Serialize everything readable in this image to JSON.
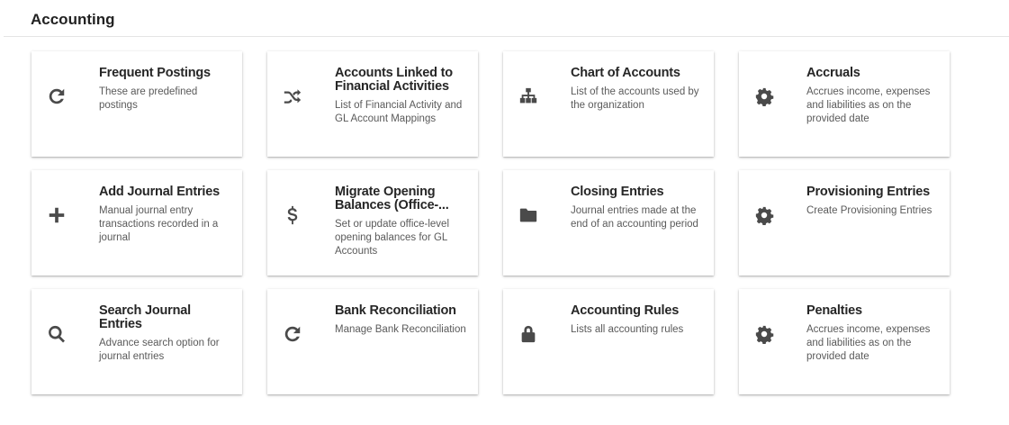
{
  "page": {
    "title": "Accounting"
  },
  "cards": [
    {
      "name": "frequent-postings",
      "icon": "refresh-icon",
      "title": "Frequent Postings",
      "desc": "These are predefined postings"
    },
    {
      "name": "accounts-linked",
      "icon": "shuffle-icon",
      "title": "Accounts Linked to Financial Activities",
      "desc": "List of Financial Activity and GL Account Mappings"
    },
    {
      "name": "chart-of-accounts",
      "icon": "sitemap-icon",
      "title": "Chart of Accounts",
      "desc": "List of the accounts used by the organization"
    },
    {
      "name": "accruals",
      "icon": "gear-icon",
      "title": "Accruals",
      "desc": "Accrues income, expenses and liabilities as on the provided date"
    },
    {
      "name": "add-journal-entries",
      "icon": "plus-icon",
      "title": "Add Journal Entries",
      "desc": "Manual journal entry transactions recorded in a journal"
    },
    {
      "name": "migrate-opening-balances",
      "icon": "dollar-icon",
      "title": "Migrate Opening Balances (Office-...",
      "desc": "Set or update office-level opening balances for GL Accounts"
    },
    {
      "name": "closing-entries",
      "icon": "folder-icon",
      "title": "Closing Entries",
      "desc": "Journal entries made at the end of an accounting period"
    },
    {
      "name": "provisioning-entries",
      "icon": "gear-icon",
      "title": "Provisioning Entries",
      "desc": "Create Provisioning Entries"
    },
    {
      "name": "search-journal-entries",
      "icon": "search-icon",
      "title": "Search Journal Entries",
      "desc": "Advance search option for journal entries"
    },
    {
      "name": "bank-reconciliation",
      "icon": "refresh-icon",
      "title": "Bank Reconciliation",
      "desc": "Manage Bank Reconciliation"
    },
    {
      "name": "accounting-rules",
      "icon": "lock-icon",
      "title": "Accounting Rules",
      "desc": "Lists all accounting rules"
    },
    {
      "name": "penalties",
      "icon": "gear-icon",
      "title": "Penalties",
      "desc": "Accrues income, expenses and liabilities as on the provided date"
    }
  ]
}
